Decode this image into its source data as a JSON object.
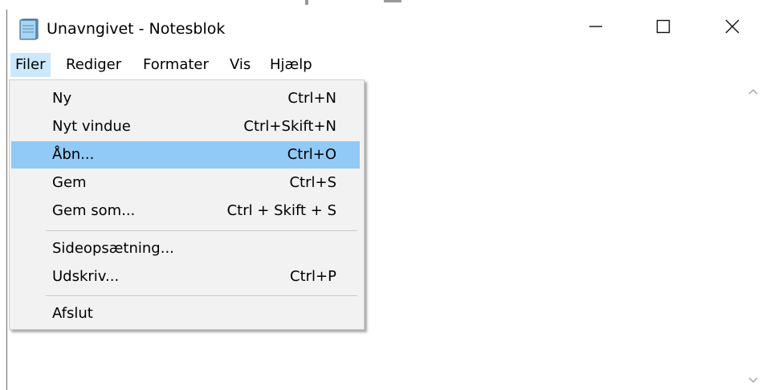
{
  "window": {
    "title": "Unavngivet - Notesblok",
    "icon": "notepad-icon",
    "controls": {
      "minimize_icon": "minimize-icon",
      "maximize_icon": "maximize-icon",
      "close_icon": "close-icon"
    }
  },
  "menubar": {
    "items": [
      {
        "label": "Filer"
      },
      {
        "label": "Rediger"
      },
      {
        "label": "Formater"
      },
      {
        "label": "Vis"
      },
      {
        "label": "Hjælp"
      }
    ],
    "active": "Filer"
  },
  "file_menu": {
    "items": [
      {
        "label": "Ny",
        "shortcut": "Ctrl+N"
      },
      {
        "label": "Nyt vindue",
        "shortcut": "Ctrl+Skift+N"
      },
      {
        "label": "Åbn...",
        "shortcut": "Ctrl+O"
      },
      {
        "label": "Gem",
        "shortcut": "Ctrl+S"
      },
      {
        "label": "Gem som...",
        "shortcut": "Ctrl + Skift + S"
      },
      {
        "label": "Sideopsætning...",
        "shortcut": ""
      },
      {
        "label": "Udskriv...",
        "shortcut": "Ctrl+P"
      },
      {
        "label": "Afslut",
        "shortcut": ""
      }
    ],
    "highlighted": "Åbn..."
  },
  "colors": {
    "menu_active": "#cce8ff",
    "item_highlight": "#91c9f7",
    "menu_background": "#f2f2f2"
  }
}
